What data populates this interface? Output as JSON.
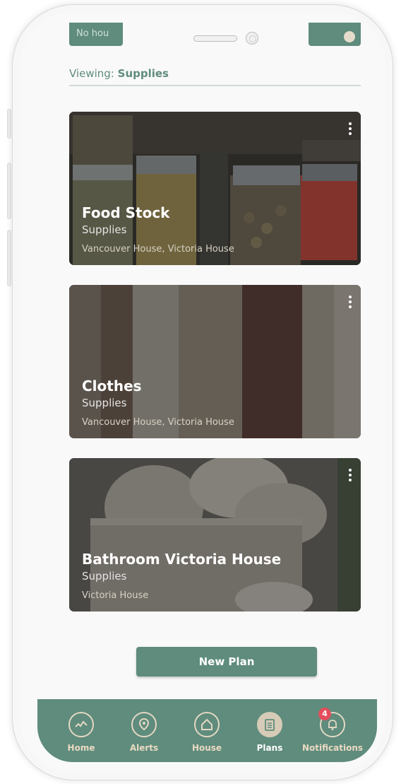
{
  "top_bar": {
    "left_button_label": "No hou"
  },
  "viewing": {
    "prefix": "Viewing:",
    "value": "Supplies"
  },
  "plans": [
    {
      "title": "Food Stock",
      "category": "Supplies",
      "locations": "Vancouver House, Victoria House"
    },
    {
      "title": "Clothes",
      "category": "Supplies",
      "locations": "Vancouver House, Victoria House"
    },
    {
      "title": "Bathroom Victoria House",
      "category": "Supplies",
      "locations": "Victoria House"
    }
  ],
  "new_plan_label": "New Plan",
  "nav": {
    "items": [
      {
        "label": "Home",
        "icon": "activity-icon"
      },
      {
        "label": "Alerts",
        "icon": "location-pin-icon"
      },
      {
        "label": "House",
        "icon": "house-icon"
      },
      {
        "label": "Plans",
        "icon": "clipboard-icon",
        "active": true
      },
      {
        "label": "Notifications",
        "icon": "bell-icon"
      }
    ],
    "notification_count": "4"
  },
  "colors": {
    "accent": "#5f8c7c",
    "nav_label": "#ead9c2",
    "badge": "#e44d5c"
  }
}
